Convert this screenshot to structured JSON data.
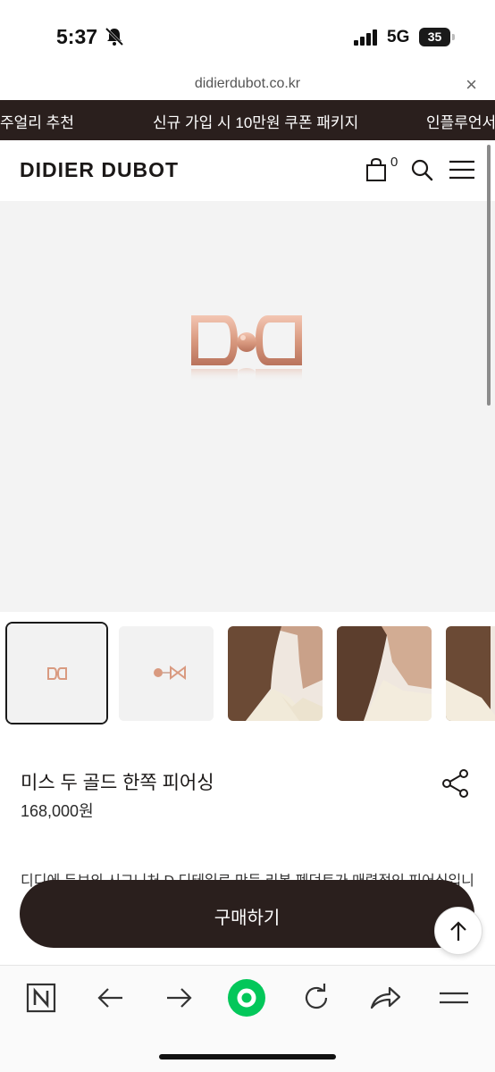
{
  "status_bar": {
    "time": "5:37",
    "network": "5G",
    "battery": "35"
  },
  "url_bar": {
    "domain": "didierdubot.co.kr",
    "close_symbol": "×"
  },
  "promo_banner": {
    "items": [
      "주얼리 추천",
      "신규 가입 시 10만원 쿠폰 패키지",
      "인플루언서"
    ]
  },
  "header": {
    "brand": "DIDIER DUBOT",
    "cart_count": "0",
    "icons": [
      "shopping-bag-icon",
      "search-icon",
      "hamburger-menu-icon"
    ]
  },
  "product": {
    "name": "미스 두 골드 한쪽 피어싱",
    "price": "168,000원",
    "description": "디디에 두보의 시그니처 D 디테일로 만든 리본 펜던트가 매력적인 피어싱입니",
    "thumbnails": [
      {
        "label": "product-front",
        "selected": true
      },
      {
        "label": "product-side",
        "selected": false
      },
      {
        "label": "model-wearing-1",
        "selected": false
      },
      {
        "label": "model-wearing-2",
        "selected": false
      },
      {
        "label": "model-wearing-3",
        "selected": false
      }
    ]
  },
  "actions": {
    "buy_label": "구매하기"
  },
  "colors": {
    "brand_dark": "#2a1f1d",
    "rose_gold": "#e0a58f",
    "browser_green": "#03c75a"
  },
  "toolbar": {
    "items": [
      "naver-home-icon",
      "back-arrow-icon",
      "forward-arrow-icon",
      "green-dot-icon",
      "reload-icon",
      "share-arrow-icon",
      "tabs-menu-icon"
    ]
  }
}
